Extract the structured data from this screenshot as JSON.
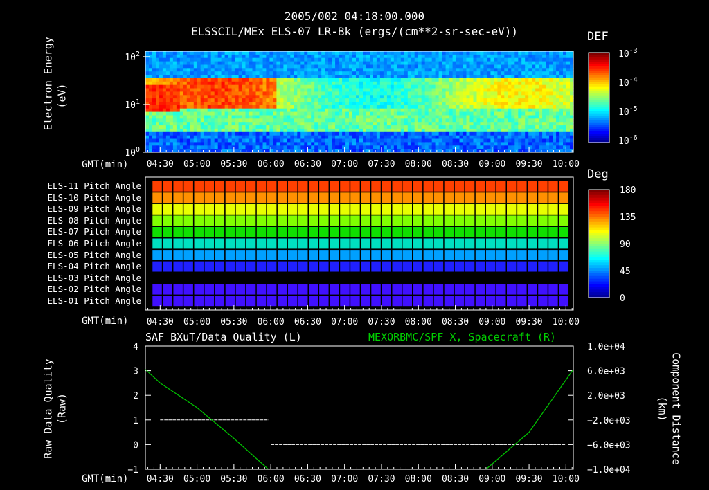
{
  "header": {
    "timestamp": "2005/002 04:18:00.000",
    "subtitle": "ELSSCIL/MEx ELS-07 LR-Bk  (ergs/(cm**2-sr-sec-eV))"
  },
  "time_axis": {
    "label": "GMT(min)",
    "ticks": [
      "04:30",
      "05:00",
      "05:30",
      "06:00",
      "06:30",
      "07:00",
      "07:30",
      "08:00",
      "08:30",
      "09:00",
      "09:30",
      "10:00"
    ]
  },
  "colors": {
    "axis": "#ffffff",
    "background": "#000000",
    "spacecraft_line": "#00c000"
  },
  "panel1": {
    "ylabel": "Electron Energy",
    "yunit": "(eV)",
    "yticks": [
      {
        "base": "10",
        "exp": "2"
      },
      {
        "base": "10",
        "exp": "1"
      },
      {
        "base": "10",
        "exp": "0"
      }
    ],
    "colorbar_title": "DEF",
    "colorbar_ticks": [
      {
        "base": "10",
        "exp": "-3"
      },
      {
        "base": "10",
        "exp": "-4"
      },
      {
        "base": "10",
        "exp": "-5"
      },
      {
        "base": "10",
        "exp": "-6"
      }
    ]
  },
  "panel2": {
    "rows": [
      "ELS-11 Pitch Angle",
      "ELS-10 Pitch Angle",
      "ELS-09 Pitch Angle",
      "ELS-08 Pitch Angle",
      "ELS-07 Pitch Angle",
      "ELS-06 Pitch Angle",
      "ELS-05 Pitch Angle",
      "ELS-04 Pitch Angle",
      "ELS-03 Pitch Angle",
      "ELS-02 Pitch Angle",
      "ELS-01 Pitch Angle"
    ],
    "row_colors": [
      "#ff4000",
      "#ff9000",
      "#e8ff00",
      "#80ff00",
      "#10e000",
      "#00e0c0",
      "#00a0ff",
      "#2020ff",
      null,
      "#4010ff",
      "#4010ff"
    ],
    "colorbar_title": "Deg",
    "colorbar_ticks": [
      "180",
      "135",
      "90",
      "45",
      "0"
    ]
  },
  "panel3": {
    "left_title": "SAF_BXuT/Data Quality (L)",
    "right_title": "MEXORBMC/SPF X, Spacecraft (R)",
    "left_ylabel": "Raw Data Quality",
    "left_yunit": "(Raw)",
    "right_ylabel": "Component Distance",
    "right_yunit": "(km)",
    "left_yticks": [
      "4",
      "3",
      "2",
      "1",
      "0",
      "−1"
    ],
    "right_yticks": [
      "1.0e+04",
      "6.0e+03",
      "2.0e+03",
      "−2.0e+03",
      "−6.0e+03",
      "−1.0e+04"
    ]
  },
  "chart_data": [
    {
      "type": "heatmap",
      "title": "ELSSCIL/MEx ELS-07 LR-Bk  (ergs/(cm**2-sr-sec-eV))",
      "xlabel": "GMT(min)",
      "ylabel": "Electron Energy (eV)",
      "yscale": "log",
      "ylim": [
        1,
        130
      ],
      "xlim": [
        "04:18",
        "10:06"
      ],
      "colorbar": {
        "label": "DEF",
        "scale": "log",
        "range": [
          1e-06,
          0.001
        ]
      }
    },
    {
      "type": "heatmap",
      "xlabel": "GMT(min)",
      "categories": [
        "ELS-11",
        "ELS-10",
        "ELS-09",
        "ELS-08",
        "ELS-07",
        "ELS-06",
        "ELS-05",
        "ELS-04",
        "ELS-03",
        "ELS-02",
        "ELS-01"
      ],
      "pitch_angle_deg": [
        165,
        148,
        125,
        105,
        95,
        75,
        55,
        38,
        null,
        28,
        28
      ],
      "colorbar": {
        "label": "Deg",
        "range": [
          0,
          180
        ]
      }
    },
    {
      "type": "line",
      "xlabel": "GMT(min)",
      "series": [
        {
          "name": "SAF_BXuT/Data Quality (L)",
          "axis": "left",
          "x": [
            "04:30",
            "05:58",
            "06:00",
            "10:00"
          ],
          "y": [
            1,
            1,
            0,
            0
          ]
        },
        {
          "name": "MEXORBMC/SPF X, Spacecraft (R)",
          "axis": "right",
          "x": [
            "04:18",
            "04:30",
            "05:00",
            "05:30",
            "05:58",
            "06:30",
            "07:00",
            "07:30",
            "08:00",
            "08:30",
            "08:55",
            "09:30",
            "10:06"
          ],
          "y": [
            6200,
            4000,
            0,
            -5000,
            -10000,
            -12000,
            -12500,
            -12300,
            -11800,
            -10800,
            -10000,
            -4000,
            6200
          ]
        }
      ],
      "left_ylim": [
        -1,
        4
      ],
      "right_ylim": [
        -10000,
        10000
      ]
    }
  ]
}
